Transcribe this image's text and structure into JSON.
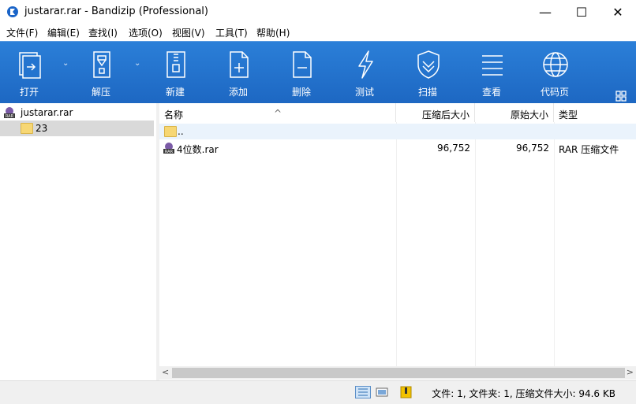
{
  "window": {
    "title": "justarar.rar - Bandizip (Professional)",
    "minimize": "—",
    "maximize": "☐",
    "close": "✕"
  },
  "menu": [
    "文件(F)",
    "编辑(E)",
    "查找(I)",
    "选项(O)",
    "视图(V)",
    "工具(T)",
    "帮助(H)"
  ],
  "toolbar": {
    "open": "打开",
    "extract": "解压",
    "new": "新建",
    "add": "添加",
    "delete": "删除",
    "test": "测试",
    "scan": "扫描",
    "view": "查看",
    "codepage": "代码页"
  },
  "tree": {
    "root": "justarar.rar",
    "folder": "23",
    "root_badge": "RAR"
  },
  "list": {
    "columns": [
      "名称",
      "压缩后大小",
      "原始大小",
      "类型"
    ],
    "sort_indicator": "^",
    "parent": "..",
    "rows": [
      {
        "name": "4位数.rar",
        "packed": "96,752",
        "size": "96,752",
        "type": "RAR 压缩文件",
        "badge": "RAR"
      }
    ]
  },
  "scrollbar": {
    "left": "<",
    "right": ">"
  },
  "status": {
    "text": "文件: 1, 文件夹: 1, 压缩文件大小: 94.6 KB"
  },
  "colors": {
    "toolbar": "#1d67c2",
    "accent": "#2b7fd8"
  }
}
